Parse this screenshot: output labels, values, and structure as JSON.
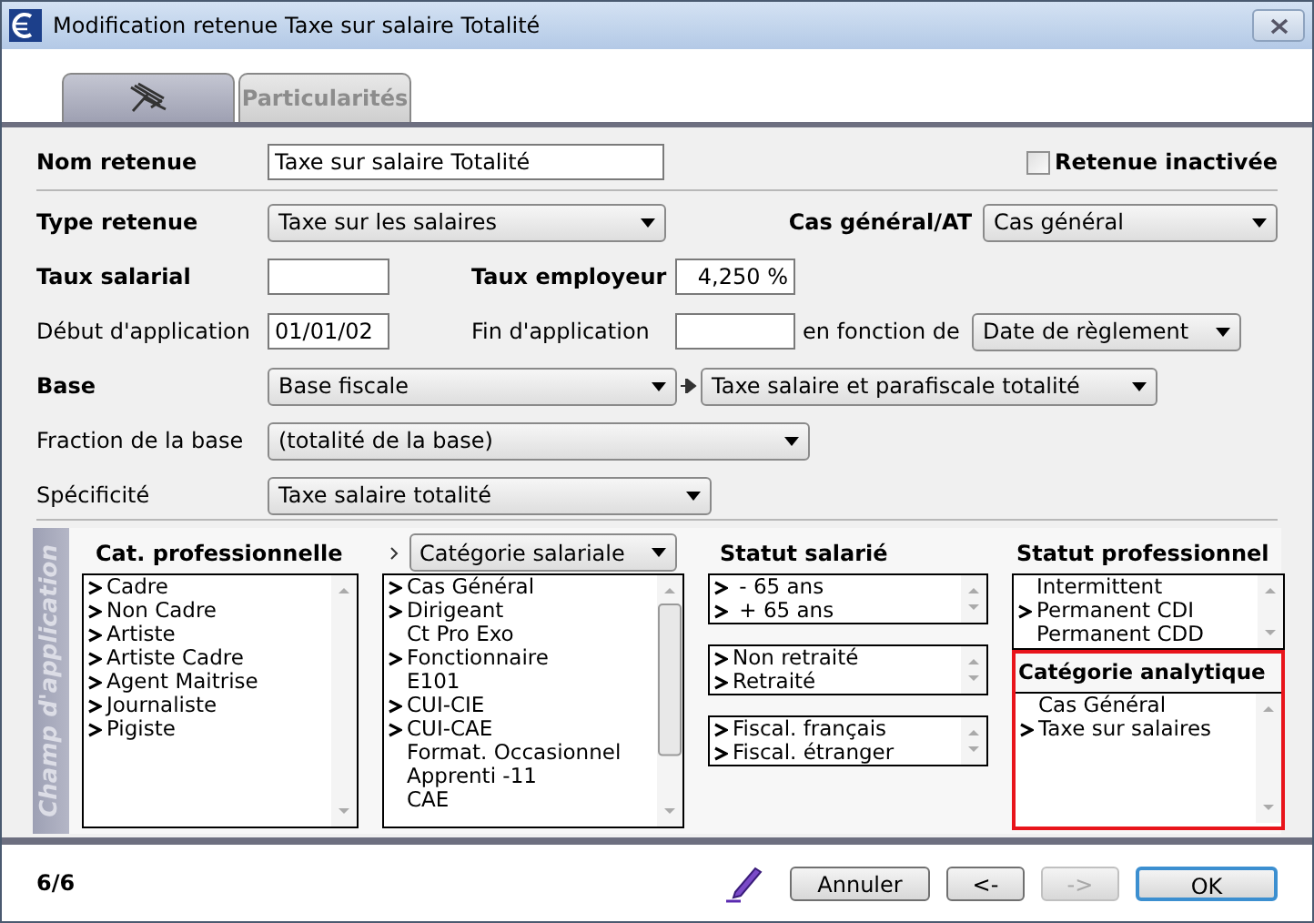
{
  "window": {
    "title": "Modification retenue Taxe sur salaire Totalité"
  },
  "tabs": [
    {
      "kind": "icon",
      "selected": true
    },
    {
      "kind": "text",
      "label": "Particularités",
      "selected": false
    }
  ],
  "form": {
    "nom_retenue": {
      "label": "Nom retenue",
      "value": "Taxe sur salaire Totalité"
    },
    "retenue_inactivee": {
      "label": "Retenue inactivée",
      "checked": false
    },
    "type_retenue": {
      "label": "Type retenue",
      "value": "Taxe sur les salaires"
    },
    "cas_general_at": {
      "label": "Cas général/AT",
      "value": "Cas général"
    },
    "taux_salarial": {
      "label": "Taux salarial"
    },
    "taux_employeur": {
      "label": "Taux employeur",
      "value": "4,250 %"
    },
    "debut_application": {
      "label": "Début d'application",
      "value": "01/01/02"
    },
    "fin_application": {
      "label": "Fin d'application"
    },
    "en_fonction_de": {
      "label": "en fonction de",
      "value": "Date de règlement"
    },
    "base": {
      "label": "Base",
      "value": "Base fiscale",
      "sub_value": "Taxe salaire et parafiscale totalité"
    },
    "fraction_base": {
      "label": "Fraction de la base",
      "value": "(totalité de la base)"
    },
    "specificite": {
      "label": "Spécificité",
      "value": "Taxe salaire totalité"
    }
  },
  "champ_application": {
    "title": "Champ d'application",
    "cat_professionnelle": {
      "label": "Cat. professionnelle",
      "items": [
        {
          "label": "Cadre",
          "selected": true
        },
        {
          "label": "Non Cadre",
          "selected": true
        },
        {
          "label": "Artiste",
          "selected": true
        },
        {
          "label": "Artiste Cadre",
          "selected": true
        },
        {
          "label": "Agent Maitrise",
          "selected": true
        },
        {
          "label": "Journaliste",
          "selected": true
        },
        {
          "label": "Pigiste",
          "selected": true
        }
      ]
    },
    "categorie": {
      "value": "Catégorie salariale",
      "items": [
        {
          "label": "Cas Général",
          "selected": true
        },
        {
          "label": "Dirigeant",
          "selected": true
        },
        {
          "label": "Ct Pro Exo",
          "selected": false
        },
        {
          "label": "Fonctionnaire",
          "selected": true
        },
        {
          "label": "E101",
          "selected": false
        },
        {
          "label": "CUI-CIE",
          "selected": true
        },
        {
          "label": "CUI-CAE",
          "selected": true
        },
        {
          "label": "Format. Occasionnel",
          "selected": false
        },
        {
          "label": "Apprenti -11",
          "selected": false
        },
        {
          "label": "CAE",
          "selected": false
        }
      ]
    },
    "statut_salarie": {
      "label": "Statut salarié",
      "lists": [
        [
          {
            "label": " - 65 ans",
            "selected": true
          },
          {
            "label": " + 65 ans",
            "selected": true
          }
        ],
        [
          {
            "label": "Non retraité",
            "selected": true
          },
          {
            "label": "Retraité",
            "selected": true
          }
        ],
        [
          {
            "label": "Fiscal. français",
            "selected": true
          },
          {
            "label": "Fiscal. étranger",
            "selected": true
          }
        ]
      ]
    },
    "statut_professionnel": {
      "label": "Statut professionnel",
      "items": [
        {
          "label": "Intermittent",
          "selected": false
        },
        {
          "label": "Permanent CDI",
          "selected": true
        },
        {
          "label": "Permanent CDD",
          "selected": false
        }
      ]
    },
    "categorie_analytique": {
      "label": "Catégorie analytique",
      "highlighted": true,
      "items": [
        {
          "label": "Cas Général",
          "selected": false
        },
        {
          "label": "Taxe sur salaires",
          "selected": true
        }
      ]
    }
  },
  "footer": {
    "counter": "6/6",
    "buttons": [
      {
        "kind": "normal",
        "label": "Annuler",
        "disabled": false
      },
      {
        "kind": "normal",
        "label": "<-",
        "disabled": false
      },
      {
        "kind": "normal",
        "label": "->",
        "disabled": true
      },
      {
        "kind": "default",
        "label": "OK",
        "disabled": false
      }
    ]
  }
}
